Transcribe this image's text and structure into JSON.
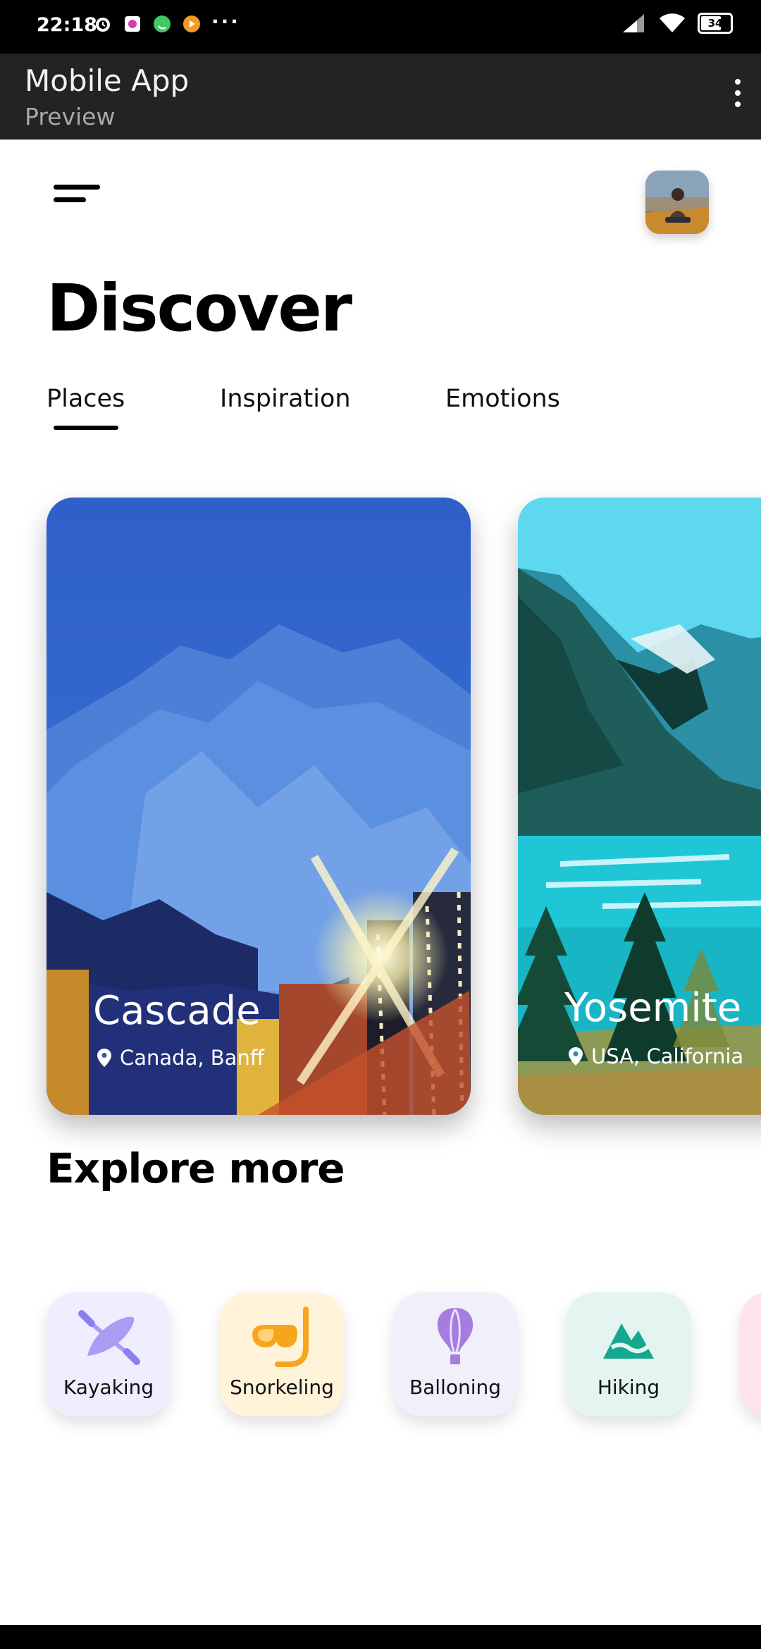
{
  "status_bar": {
    "time": "22:18",
    "battery": "34",
    "overflow": "···",
    "icons": [
      "alarm-icon",
      "gallery-icon",
      "whatsapp-icon",
      "media-icon",
      "signal-icon",
      "wifi-icon",
      "battery-icon"
    ]
  },
  "appbar": {
    "title": "Mobile App",
    "subtitle": "Preview",
    "menu_icon": "more-vertical-icon"
  },
  "header": {
    "menu_icon": "hamburger-menu-icon",
    "avatar_icon": "user-avatar"
  },
  "page": {
    "title": "Discover"
  },
  "tabs": [
    {
      "label": "Places",
      "selected": true
    },
    {
      "label": "Inspiration",
      "selected": false
    },
    {
      "label": "Emotions",
      "selected": false
    }
  ],
  "cards": [
    {
      "title": "Cascade",
      "location": "Canada, Banff"
    },
    {
      "title": "Yosemite",
      "location": "USA, California"
    }
  ],
  "explore": {
    "title": "Explore more",
    "items": [
      {
        "label": "Kayaking",
        "icon": "kayak-icon",
        "bg": "#efeefe",
        "color": "#a99cf5"
      },
      {
        "label": "Snorkeling",
        "icon": "snorkel-mask-icon",
        "bg": "#fff3d9",
        "color": "#f7a51c"
      },
      {
        "label": "Balloning",
        "icon": "hot-air-balloon-icon",
        "bg": "#f1eff9",
        "color": "#a57de0"
      },
      {
        "label": "Hiking",
        "icon": "mountain-icon",
        "bg": "#e4f4f1",
        "color": "#14a98e"
      }
    ]
  },
  "bottom_nav": [
    {
      "name": "home-grid-icon"
    },
    {
      "name": "stats-icon"
    },
    {
      "name": "search-icon"
    },
    {
      "name": "profile-icon"
    }
  ],
  "colors": {
    "appbar_bg": "#232323",
    "text": "#000000",
    "background": "#ffffff"
  }
}
